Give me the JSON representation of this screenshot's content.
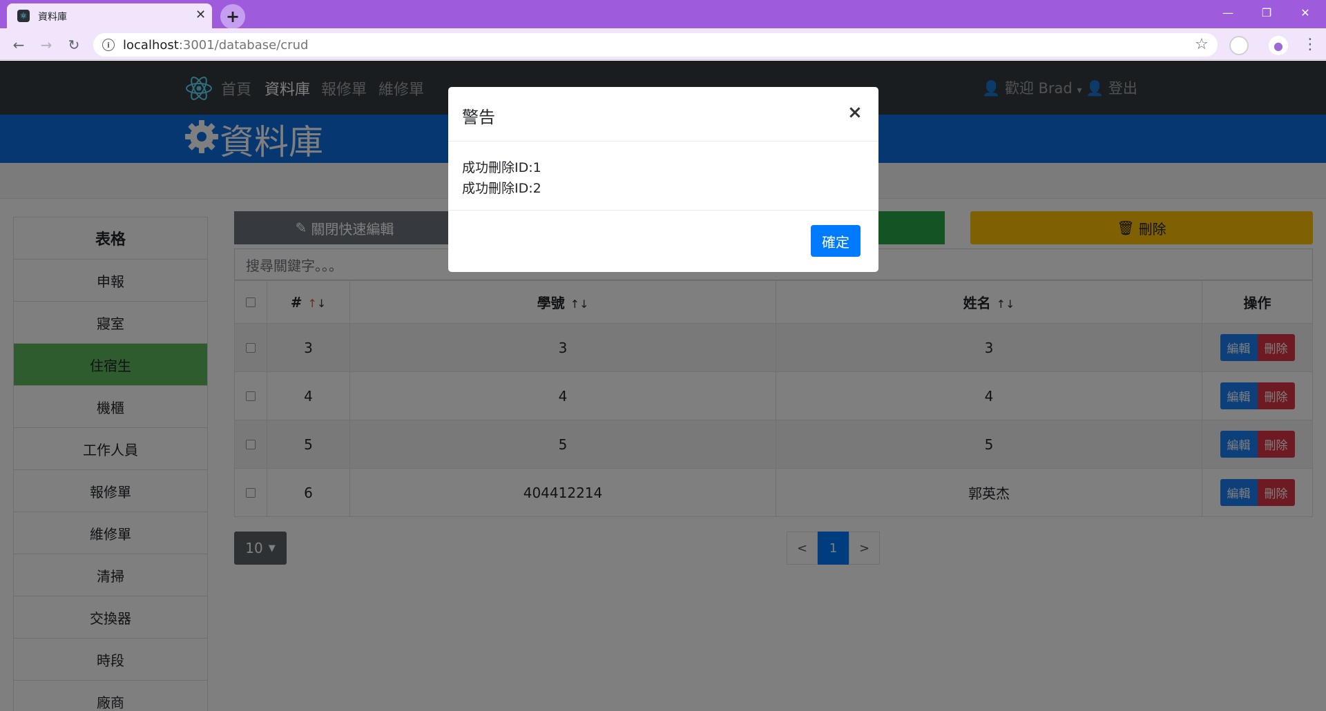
{
  "browser": {
    "tab_title": "資料庫",
    "new_tab": "+",
    "url_host": "localhost",
    "url_path": ":3001/database/crud",
    "icons": [
      "back-icon",
      "forward-icon",
      "reload-icon",
      "info-icon",
      "star-icon",
      "extension-icon",
      "profile-icon",
      "menu-icon",
      "minimize-icon",
      "maximize-icon",
      "close-icon"
    ]
  },
  "navbar": {
    "home": "首頁",
    "database": "資料庫",
    "repair": "報修單",
    "maintenance": "維修單",
    "welcome": "歡迎 Brad",
    "logout": "登出"
  },
  "banner": {
    "title": "資料庫"
  },
  "sidebar": {
    "items": [
      {
        "label": "表格"
      },
      {
        "label": "申報"
      },
      {
        "label": "寢室"
      },
      {
        "label": "住宿生"
      },
      {
        "label": "機櫃"
      },
      {
        "label": "工作人員"
      },
      {
        "label": "報修單"
      },
      {
        "label": "維修單"
      },
      {
        "label": "清掃"
      },
      {
        "label": "交換器"
      },
      {
        "label": "時段"
      },
      {
        "label": "廠商"
      }
    ],
    "active_index": 3
  },
  "actions": {
    "quick_edit": "關閉快速編輯",
    "delete": "刪除"
  },
  "search": {
    "placeholder": "搜尋關鍵字。。。"
  },
  "table": {
    "headers": [
      "#",
      "學號",
      "姓名",
      "操作"
    ],
    "sort_arrow": "↑↓",
    "rows": [
      {
        "id": "3",
        "student_no": "3",
        "name": "3"
      },
      {
        "id": "4",
        "student_no": "4",
        "name": "4"
      },
      {
        "id": "5",
        "student_no": "5",
        "name": "5"
      },
      {
        "id": "6",
        "student_no": "404412214",
        "name": "郭英杰"
      }
    ],
    "edit_label": "編輯",
    "delete_label": "刪除"
  },
  "pagination": {
    "page_size": "10",
    "prev": "<",
    "current": "1",
    "next": ">"
  },
  "modal": {
    "title": "警告",
    "close": "×",
    "messages": [
      "成功刪除ID:1",
      "成功刪除ID:2"
    ],
    "confirm": "確定"
  },
  "colors": {
    "tab_bar": "#9e5bdc",
    "navbar": "#343a40",
    "banner": "#0d6fe0",
    "active_sidebar": "#5cb85c",
    "delete_btn": "#ffc107",
    "primary": "#007bff"
  }
}
